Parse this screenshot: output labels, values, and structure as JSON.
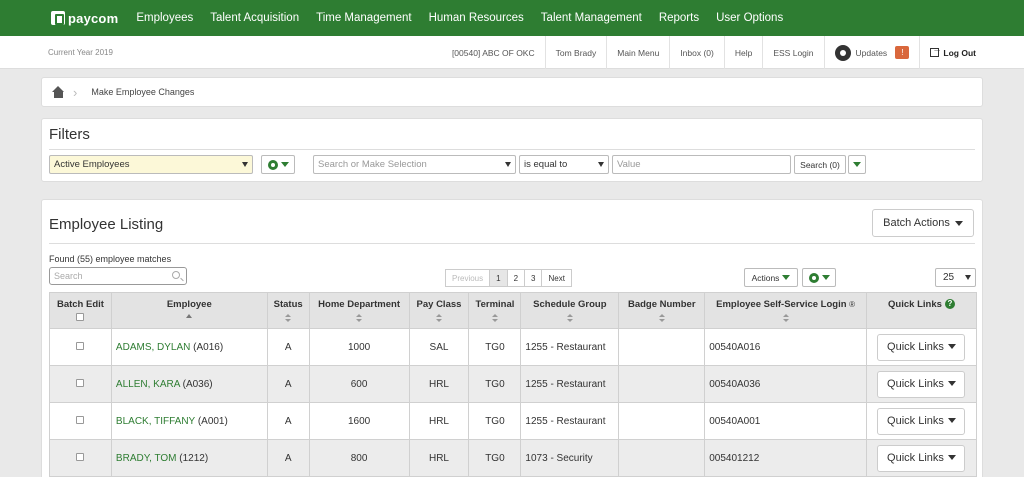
{
  "brand": {
    "logo_text": "paycom",
    "accent": "#2e7d32"
  },
  "topnav": [
    "Employees",
    "Talent Acquisition",
    "Time Management",
    "Human Resources",
    "Talent Management",
    "Reports",
    "User Options"
  ],
  "subbar": {
    "current_year": "Current Year 2019",
    "company": "[00540] ABC OF OKC",
    "user": "Tom Brady",
    "main_menu": "Main Menu",
    "inbox": "Inbox (0)",
    "help": "Help",
    "ess_login": "ESS Login",
    "updates": "Updates",
    "updates_count": "!",
    "logout": "Log Out"
  },
  "breadcrumb": {
    "current": "Make Employee Changes"
  },
  "filters": {
    "title": "Filters",
    "employee_set": "Active Employees",
    "field_placeholder": "Search or Make Selection",
    "operator": "is equal to",
    "value_placeholder": "Value",
    "search_button": "Search (0)"
  },
  "listing": {
    "title": "Employee Listing",
    "batch_actions": "Batch Actions",
    "found": "Found (55) employee matches",
    "search_placeholder": "Search",
    "pager": {
      "previous": "Previous",
      "pages": [
        "1",
        "2",
        "3"
      ],
      "next": "Next",
      "current": "1"
    },
    "actions": "Actions",
    "per_page": "25",
    "columns": [
      "Batch Edit",
      "Employee",
      "Status",
      "Home Department",
      "Pay Class",
      "Terminal",
      "Schedule Group",
      "Badge Number",
      "Employee Self-Service Login",
      "Quick Links"
    ],
    "quick_links_label": "Quick Links",
    "rows": [
      {
        "name": "ADAMS, DYLAN",
        "code": "(A016)",
        "status": "A",
        "dept": "1000",
        "pay_class": "SAL",
        "terminal": "TG0",
        "schedule": "1255 - Restaurant",
        "badge": "",
        "ess_login": "00540A016"
      },
      {
        "name": "ALLEN, KARA",
        "code": "(A036)",
        "status": "A",
        "dept": "600",
        "pay_class": "HRL",
        "terminal": "TG0",
        "schedule": "1255 - Restaurant",
        "badge": "",
        "ess_login": "00540A036"
      },
      {
        "name": "BLACK, TIFFANY",
        "code": "(A001)",
        "status": "A",
        "dept": "1600",
        "pay_class": "HRL",
        "terminal": "TG0",
        "schedule": "1255 - Restaurant",
        "badge": "",
        "ess_login": "00540A001"
      },
      {
        "name": "BRADY, TOM",
        "code": "(1212)",
        "status": "A",
        "dept": "800",
        "pay_class": "HRL",
        "terminal": "TG0",
        "schedule": "1073 - Security",
        "badge": "",
        "ess_login": "005401212"
      }
    ]
  }
}
